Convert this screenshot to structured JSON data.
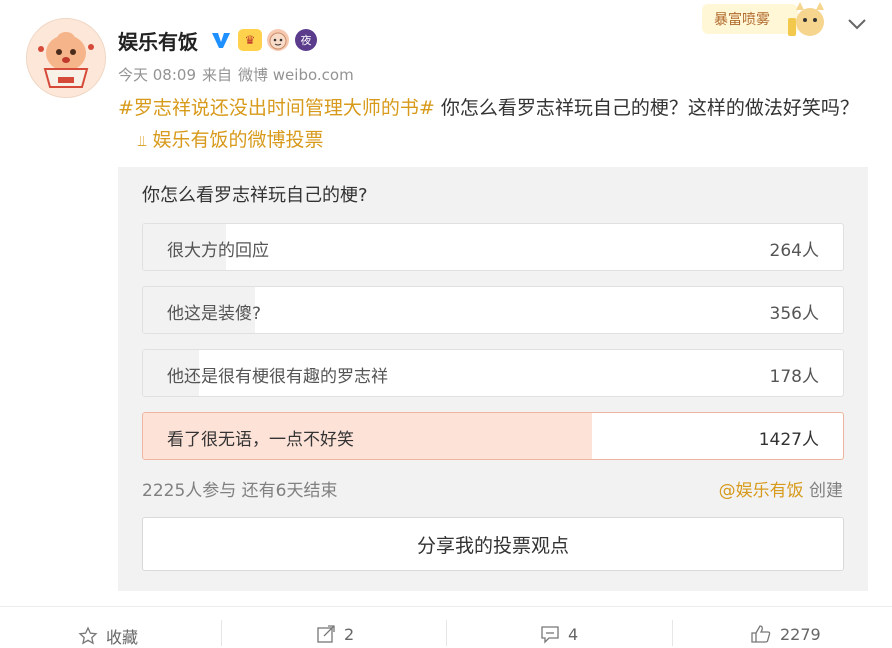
{
  "user": {
    "name": "娱乐有饭"
  },
  "meta": {
    "time": "今天 08:09",
    "source_prefix": "来自",
    "source": "微博 weibo.com"
  },
  "post": {
    "hashtag": "#罗志祥说还没出时间管理大师的书#",
    "text": " 你怎么看罗志祥玩自己的梗？这样的做法好笑吗？",
    "vote_link": "娱乐有饭的微博投票"
  },
  "decor": {
    "text": "暴富喷雾"
  },
  "poll": {
    "question": "你怎么看罗志祥玩自己的梗?",
    "options": [
      {
        "label": "很大方的回应",
        "count": "264人",
        "share": 0.119
      },
      {
        "label": "他这是装傻?",
        "count": "356人",
        "share": 0.16
      },
      {
        "label": "他还是很有梗很有趣的罗志祥",
        "count": "178人",
        "share": 0.08
      },
      {
        "label": "看了很无语，一点不好笑",
        "count": "1427人",
        "share": 0.641
      }
    ],
    "stats": "2225人参与 还有6天结束",
    "creator_at": "@娱乐有饭",
    "creator_suffix": "创建",
    "share_button": "分享我的投票观点"
  },
  "footer": {
    "favorite": "收藏",
    "repost": "2",
    "comment": "4",
    "like": "2279"
  },
  "colors": {
    "accent": "#d79a1b",
    "chosen_fill": "#fde2d8",
    "verified": "#1e90ff"
  }
}
